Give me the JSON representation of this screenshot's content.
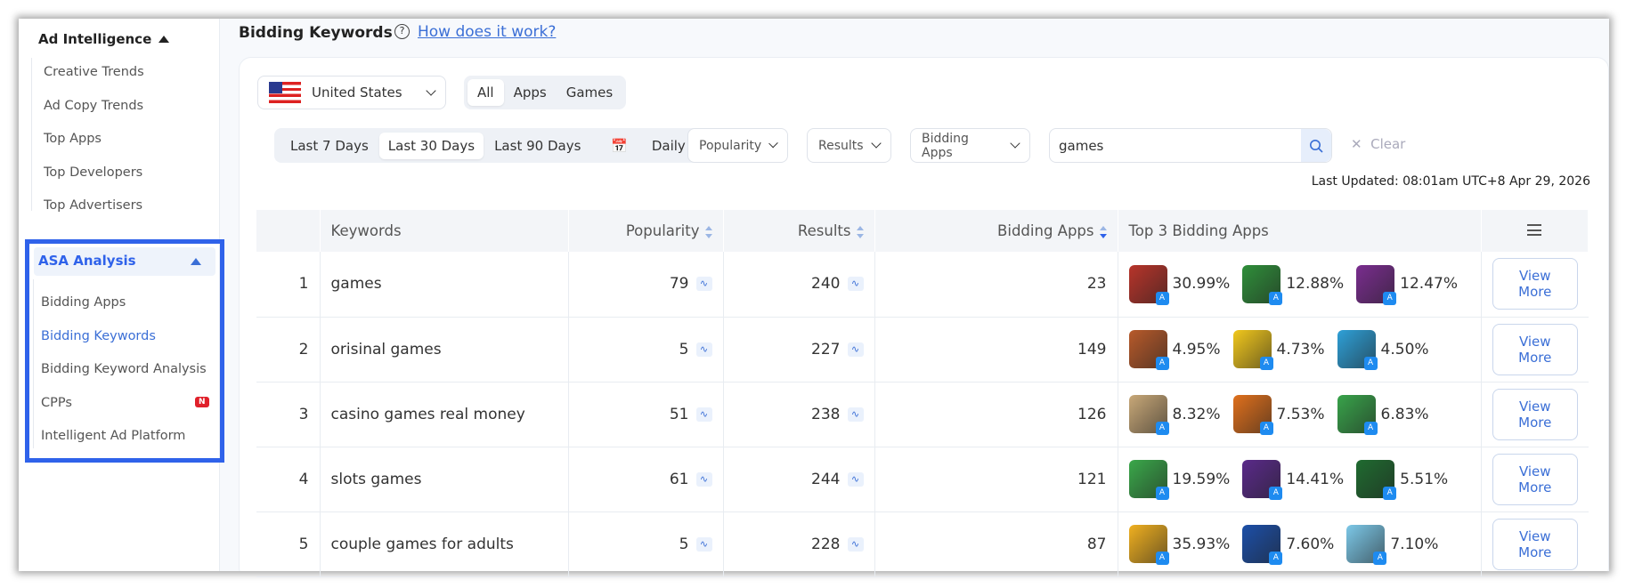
{
  "sidebar": {
    "ad_intelligence": {
      "label": "Ad Intelligence",
      "items": [
        "Creative Trends",
        "Ad Copy Trends",
        "Top Apps",
        "Top Developers",
        "Top Advertisers"
      ]
    },
    "asa_analysis": {
      "label": "ASA Analysis",
      "items": [
        "Bidding Apps",
        "Bidding Keywords",
        "Bidding Keyword Analysis",
        "CPPs",
        "Intelligent Ad Platform"
      ],
      "active": "Bidding Keywords",
      "new_badge": "N"
    }
  },
  "header": {
    "title": "Bidding Keywords",
    "help_link": "How does it work?"
  },
  "filters": {
    "country": "United States",
    "type_tabs": [
      "All",
      "Apps",
      "Games"
    ],
    "type_selected": "All",
    "date_tabs": [
      "Last 7 Days",
      "Last 30 Days",
      "Last 90 Days"
    ],
    "date_selected": "Last 30 Days",
    "granularity": "Daily",
    "popularity": "Popularity",
    "results": "Results",
    "bidding_apps": "Bidding Apps",
    "search_value": "games",
    "clear": "Clear"
  },
  "last_updated": "Last Updated: 08:01am UTC+8 Apr 29, 2026",
  "table": {
    "columns": [
      "",
      "Keywords",
      "Popularity",
      "Results",
      "Bidding Apps",
      "Top 3 Bidding Apps"
    ],
    "action_label": "View More",
    "rows": [
      {
        "rank": "1",
        "keyword": "games",
        "popularity": "79",
        "results": "240",
        "bidding_apps": "23",
        "top": [
          {
            "share": "30.99%",
            "color": "#b8342a"
          },
          {
            "share": "12.88%",
            "color": "#2f8f3a"
          },
          {
            "share": "12.47%",
            "color": "#7a2d8f"
          }
        ]
      },
      {
        "rank": "2",
        "keyword": "orisinal games",
        "popularity": "5",
        "results": "227",
        "bidding_apps": "149",
        "top": [
          {
            "share": "4.95%",
            "color": "#b85a2a"
          },
          {
            "share": "4.73%",
            "color": "#f2c81c"
          },
          {
            "share": "4.50%",
            "color": "#2ea0d8"
          }
        ]
      },
      {
        "rank": "3",
        "keyword": "casino games real money",
        "popularity": "51",
        "results": "238",
        "bidding_apps": "126",
        "top": [
          {
            "share": "8.32%",
            "color": "#c8a878"
          },
          {
            "share": "7.53%",
            "color": "#e0701c"
          },
          {
            "share": "6.83%",
            "color": "#38a34a"
          }
        ]
      },
      {
        "rank": "4",
        "keyword": "slots games",
        "popularity": "61",
        "results": "244",
        "bidding_apps": "121",
        "top": [
          {
            "share": "19.59%",
            "color": "#3aa84a"
          },
          {
            "share": "14.41%",
            "color": "#5a2a8a"
          },
          {
            "share": "5.51%",
            "color": "#1f6b30"
          }
        ]
      },
      {
        "rank": "5",
        "keyword": "couple games for adults",
        "popularity": "5",
        "results": "228",
        "bidding_apps": "87",
        "top": [
          {
            "share": "35.93%",
            "color": "#f0b020"
          },
          {
            "share": "7.60%",
            "color": "#1c4fa8"
          },
          {
            "share": "7.10%",
            "color": "#7cc8e8"
          }
        ]
      }
    ]
  }
}
